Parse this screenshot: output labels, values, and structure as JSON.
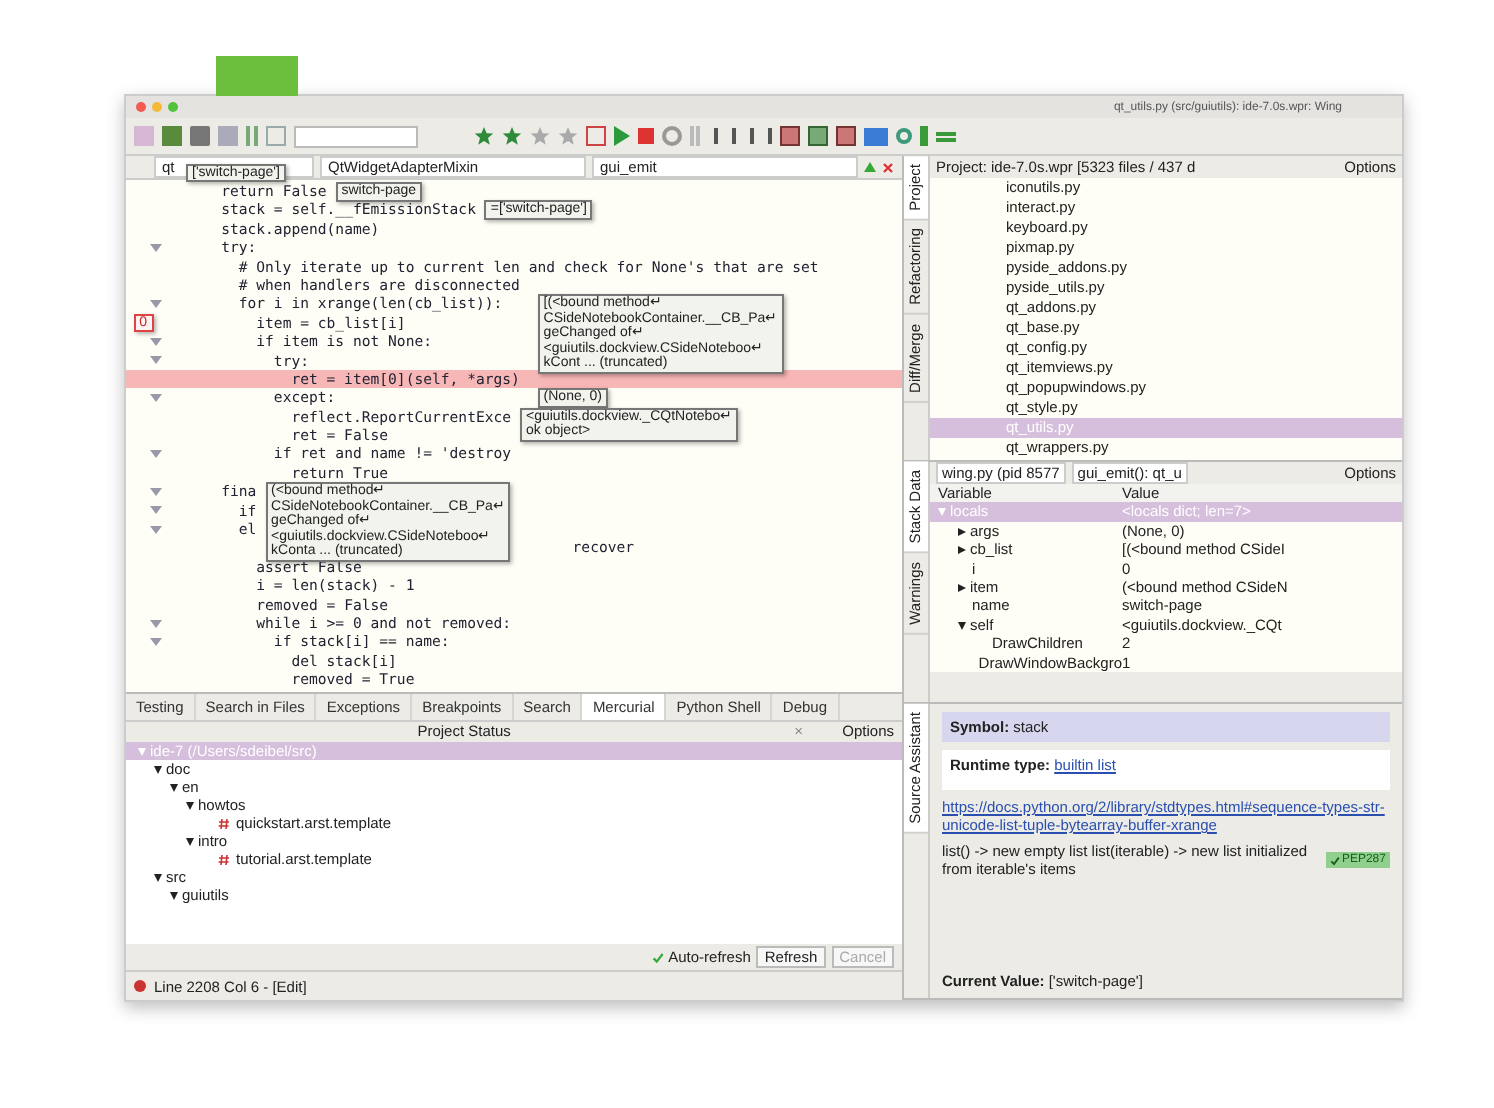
{
  "window": {
    "title": "qt_utils.py (src/guiutils): ide-7.0s.wpr: Wing"
  },
  "editor": {
    "nav": {
      "file": "qt",
      "scope": "QtWidgetAdapterMixin",
      "function": "gui_emit"
    },
    "lines": [
      {
        "text": "    return False",
        "fold": false,
        "highlighted": false
      },
      {
        "text": "    stack = self.__fEmissionStack",
        "fold": false,
        "highlighted": false
      },
      {
        "text": "    stack.append(name)",
        "fold": false,
        "highlighted": false
      },
      {
        "text": "    try:",
        "fold": true,
        "highlighted": false
      },
      {
        "text": "      # Only iterate up to current len and check for None's that are set",
        "fold": false,
        "highlighted": false
      },
      {
        "text": "      # when handlers are disconnected",
        "fold": false,
        "highlighted": false
      },
      {
        "text": "      for i in xrange(len(cb_list)):",
        "fold": true,
        "highlighted": false
      },
      {
        "text": "        item = cb_list[i]",
        "fold": false,
        "highlighted": false
      },
      {
        "text": "        if item is not None:",
        "fold": true,
        "highlighted": false
      },
      {
        "text": "          try:",
        "fold": true,
        "highlighted": false
      },
      {
        "text": "            ret = item[0](self, *args)",
        "fold": false,
        "highlighted": true
      },
      {
        "text": "          except:",
        "fold": true,
        "highlighted": false
      },
      {
        "text": "            reflect.ReportCurrentExce",
        "fold": false,
        "highlighted": false
      },
      {
        "text": "            ret = False",
        "fold": false,
        "highlighted": false
      },
      {
        "text": "          if ret and name != 'destroy",
        "fold": true,
        "highlighted": false
      },
      {
        "text": "            return True",
        "fold": false,
        "highlighted": false
      },
      {
        "text": "    fina",
        "fold": true,
        "highlighted": false
      },
      {
        "text": "      if",
        "fold": true,
        "highlighted": false
      },
      {
        "text": "      el",
        "fold": true,
        "highlighted": false
      },
      {
        "text": "                                            recover",
        "fold": false,
        "highlighted": false
      },
      {
        "text": "        assert False",
        "fold": false,
        "highlighted": false
      },
      {
        "text": "        i = len(stack) - 1",
        "fold": false,
        "highlighted": false
      },
      {
        "text": "        removed = False",
        "fold": false,
        "highlighted": false
      },
      {
        "text": "        while i >= 0 and not removed:",
        "fold": true,
        "highlighted": false
      },
      {
        "text": "          if stack[i] == name:",
        "fold": true,
        "highlighted": false
      },
      {
        "text": "            del stack[i]",
        "fold": false,
        "highlighted": false
      },
      {
        "text": "            removed = True",
        "fold": false,
        "highlighted": false
      }
    ],
    "tooltips": [
      {
        "kind": "value",
        "lines": [
          "['switch-page']"
        ]
      },
      {
        "kind": "value",
        "lines": [
          "switch-page"
        ]
      },
      {
        "kind": "value",
        "lines": [
          "=['switch-page']"
        ]
      },
      {
        "kind": "index",
        "lines": [
          "0"
        ]
      },
      {
        "kind": "value",
        "lines": [
          "[(<bound method↵",
          "CSideNotebookContainer.__CB_Pa↵",
          "geChanged of↵",
          "<guiutils.dockview.CSideNoteboo↵",
          "kCont ... (truncated)"
        ]
      },
      {
        "kind": "value",
        "lines": [
          "(None, 0)"
        ]
      },
      {
        "kind": "value",
        "lines": [
          "<guiutils.dockview._CQtNotebo↵",
          "ok object>"
        ]
      },
      {
        "kind": "value",
        "lines": [
          "(<bound method↵",
          "CSideNotebookContainer.__CB_Pa↵",
          "geChanged of↵",
          "<guiutils.dockview.CSideNoteboo↵",
          "kConta ... (truncated)"
        ]
      }
    ]
  },
  "bottom_panel": {
    "tabs": [
      {
        "label": "Testing",
        "selected": false
      },
      {
        "label": "Search in Files",
        "selected": false
      },
      {
        "label": "Exceptions",
        "selected": false
      },
      {
        "label": "Breakpoints",
        "selected": false
      },
      {
        "label": "Search",
        "selected": false
      },
      {
        "label": "Mercurial",
        "selected": true
      },
      {
        "label": "Python Shell",
        "selected": false
      },
      {
        "label": "Debug",
        "selected": false
      }
    ],
    "header": "Project Status",
    "close": "×",
    "options": "Options",
    "tree": [
      {
        "label": "ide-7 (/Users/sdeibel/src)",
        "selected": true,
        "expanded": true,
        "children": [
          {
            "label": "doc",
            "selected": false,
            "expanded": true,
            "children": [
              {
                "label": "en",
                "selected": false,
                "expanded": true,
                "children": [
                  {
                    "label": "howtos",
                    "selected": false,
                    "expanded": true,
                    "children": [
                      {
                        "label": "quickstart.arst.template",
                        "selected": false
                      }
                    ]
                  },
                  {
                    "label": "intro",
                    "selected": false,
                    "expanded": true,
                    "children": [
                      {
                        "label": "tutorial.arst.template",
                        "selected": false
                      }
                    ]
                  }
                ]
              }
            ]
          },
          {
            "label": "src",
            "selected": false,
            "expanded": true,
            "children": [
              {
                "label": "guiutils",
                "selected": false,
                "expanded": true
              }
            ]
          }
        ]
      }
    ],
    "auto_refresh": {
      "label": "Auto-refresh",
      "checked": true
    },
    "buttons": [
      {
        "label": "Refresh",
        "disabled": false
      },
      {
        "label": "Cancel",
        "disabled": true
      }
    ]
  },
  "status_bar": {
    "text": "Line 2208 Col 6 - [Edit]"
  },
  "project_panel": {
    "tabs": [
      {
        "label": "Project",
        "selected": true
      },
      {
        "label": "Refactoring",
        "selected": false
      },
      {
        "label": "Diff/Merge",
        "selected": false
      }
    ],
    "header": "Project: ide-7.0s.wpr [5323 files / 437 d",
    "options": "Options",
    "files": [
      {
        "name": "iconutils.py",
        "selected": false
      },
      {
        "name": "interact.py",
        "selected": false
      },
      {
        "name": "keyboard.py",
        "selected": false
      },
      {
        "name": "pixmap.py",
        "selected": false
      },
      {
        "name": "pyside_addons.py",
        "selected": false
      },
      {
        "name": "pyside_utils.py",
        "selected": false
      },
      {
        "name": "qt_addons.py",
        "selected": false
      },
      {
        "name": "qt_base.py",
        "selected": false
      },
      {
        "name": "qt_config.py",
        "selected": false
      },
      {
        "name": "qt_itemviews.py",
        "selected": false
      },
      {
        "name": "qt_popupwindows.py",
        "selected": false
      },
      {
        "name": "qt_style.py",
        "selected": false
      },
      {
        "name": "qt_utils.py",
        "selected": true
      },
      {
        "name": "qt_wrappers.py",
        "selected": false
      }
    ]
  },
  "stack_panel": {
    "tabs": [
      {
        "label": "Stack Data",
        "selected": true
      },
      {
        "label": "Warnings",
        "selected": false
      }
    ],
    "process": "wing.py (pid 8577",
    "frame": "gui_emit(): qt_u",
    "options": "Options",
    "columns": [
      "Variable",
      "Value"
    ],
    "variables": [
      {
        "name": "locals",
        "value": "<locals dict; len=7>",
        "expanded": true,
        "selected": true,
        "children": [
          {
            "name": "args",
            "value": "(None, 0)",
            "expanded": false,
            "selected": false
          },
          {
            "name": "cb_list",
            "value": "[(<bound method CSideI",
            "expanded": false,
            "selected": false
          },
          {
            "name": "i",
            "value": "0",
            "selected": false
          },
          {
            "name": "item",
            "value": "(<bound method CSideN",
            "expanded": false,
            "selected": false
          },
          {
            "name": "name",
            "value": "switch-page",
            "selected": false
          },
          {
            "name": "self",
            "value": "<guiutils.dockview._CQt",
            "expanded": true,
            "selected": false,
            "children": [
              {
                "name": "DrawChildren",
                "value": "2",
                "selected": false
              },
              {
                "name": "DrawWindowBackgro",
                "value": "1",
                "selected": false
              }
            ]
          }
        ]
      }
    ]
  },
  "assistant_panel": {
    "tab": "Source Assistant",
    "symbol_label": "Symbol:",
    "symbol": "stack",
    "type_label": "Runtime type:",
    "type_link": "builtin list",
    "doc_link": "https://docs.python.org/2/library/stdtypes.html#sequence-types-str-unicode-list-tuple-bytearray-buffer-xrange",
    "description": "list() -> new empty list list(iterable) -> new list initialized from iterable's items",
    "badge": "PEP287",
    "value_label": "Current Value:",
    "value": "['switch-page']"
  }
}
